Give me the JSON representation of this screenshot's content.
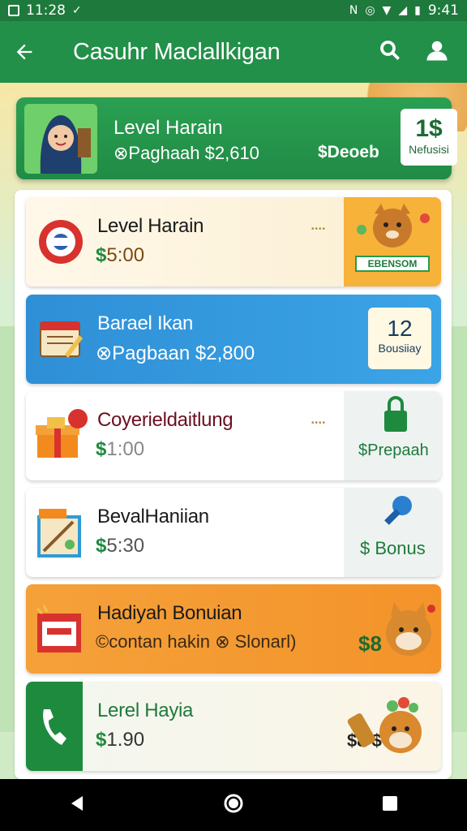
{
  "status_bar": {
    "time_left": "11:28",
    "time_right": "9:41"
  },
  "app_bar": {
    "title": "Casuhr Maclallkigan",
    "icons": [
      "back-arrow-icon",
      "search-icon",
      "profile-icon"
    ]
  },
  "hero": {
    "title": "Level Harain",
    "subtitle": "⊗Paghaah $2,610",
    "amount_label": "$Deoeb",
    "badge_number": "1$",
    "badge_label": "Nefusisi"
  },
  "cards": [
    {
      "title": "Level Harain",
      "amount": "5:00",
      "dots": "••••",
      "tag": "EBENSOM"
    },
    {
      "title": "Barael Ikan",
      "amount": "⊗Pagbaan $2,800",
      "badge_number": "12",
      "badge_label": "Bousiiay"
    },
    {
      "title": "Coyerieldaitlung",
      "amount": "1:00",
      "dots": "••••",
      "right_label": "$Prepaah"
    },
    {
      "title": "BevalHaniian",
      "amount": "5:30",
      "right_label": "$ Bonus"
    },
    {
      "title": "Hadiyah Bonuian",
      "subtitle": "©contan hakin ⊗ Slonarl)",
      "amount": "$8"
    },
    {
      "title": "Lerel Hayia",
      "amount": "1.90",
      "right_amount": "$8 $"
    }
  ],
  "colors": {
    "primary": "#229049",
    "blue": "#3ba4e6",
    "orange": "#f5a13a"
  }
}
